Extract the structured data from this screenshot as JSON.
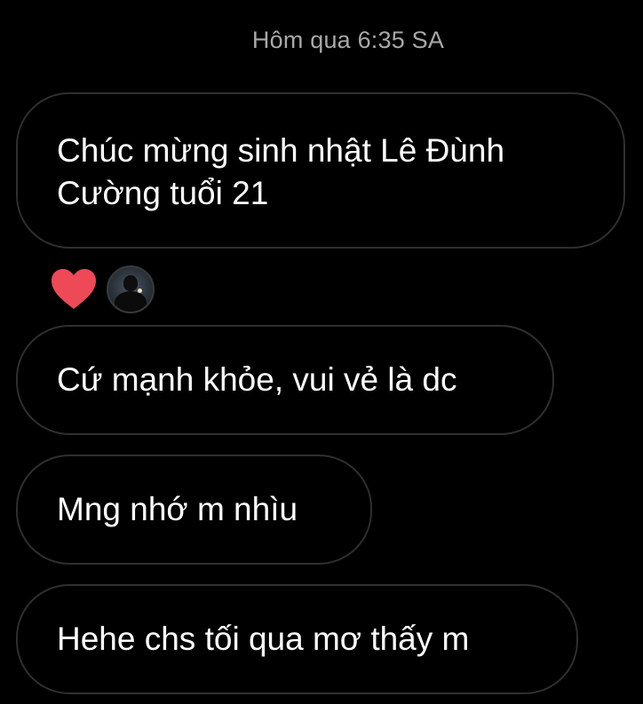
{
  "timestamp": "Hôm qua 6:35 SA",
  "messages": [
    {
      "text_line1": "Chúc mừng sinh nhật Lê Đùnh",
      "text_line2": "Cường tuổi 21"
    },
    {
      "text": "Cứ mạnh khỏe, vui vẻ là dc"
    },
    {
      "text": "Mng nhớ m nhìu"
    },
    {
      "text": "Hehe chs tối qua mơ thấy m"
    }
  ],
  "reactions": {
    "emoji": "heart-icon",
    "heart_color": "#ed4956"
  },
  "colors": {
    "background": "#000000",
    "bubble_border": "#2f2f2f",
    "text": "#ffffff",
    "timestamp": "#a8a8a8"
  }
}
